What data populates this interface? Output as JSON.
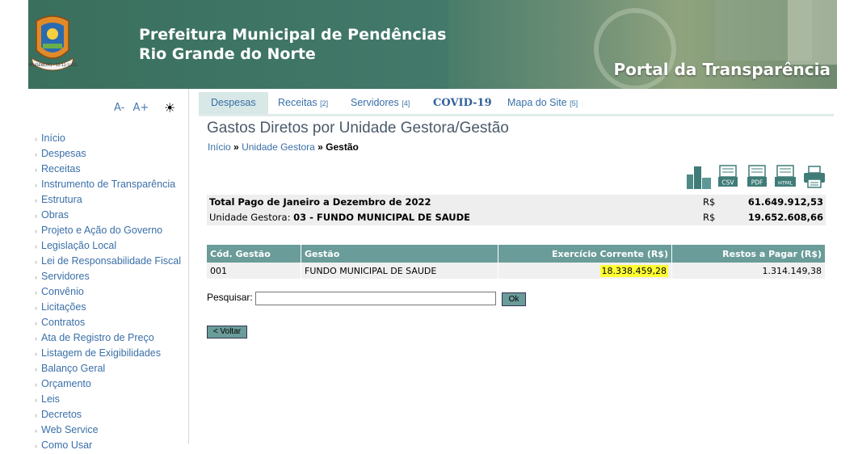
{
  "header": {
    "title_line1": "Prefeitura Municipal de Pendências",
    "title_line2": "Rio Grande do Norte",
    "portal": "Portal da Transparência",
    "logo_text": "PENDENCIAS - 12-12-1953"
  },
  "font_controls": {
    "decrease": "A-",
    "increase": "A+",
    "contrast": "☀"
  },
  "menu": [
    "Início",
    "Despesas",
    "Receitas",
    "Instrumento de Transparência",
    "Estrutura",
    "Obras",
    "Projeto e Ação do Governo",
    "Legislação Local",
    "Lei de Responsabilidade Fiscal",
    "Servidores",
    "Convênio",
    "Licitações",
    "Contratos",
    "Ata de Registro de Preço",
    "Listagem de Exigibilidades",
    "Balanço Geral",
    "Orçamento",
    "Leis",
    "Decretos",
    "Web Service",
    "Como Usar"
  ],
  "tabs": {
    "despesas": "Despesas",
    "receitas": "Receitas",
    "receitas_key": "[2]",
    "servidores": "Servidores",
    "servidores_key": "[4]",
    "covid": "COVID-19",
    "mapa": "Mapa do Site",
    "mapa_key": "[5]"
  },
  "page_title": "Gastos Diretos por Unidade Gestora/Gestão",
  "breadcrumb": {
    "inicio": "Início",
    "sep": "»",
    "unidade": "Unidade Gestora",
    "current": "Gestão"
  },
  "exports": {
    "csv": "CSV",
    "pdf": "PDF",
    "html": "HTML"
  },
  "summary": {
    "total_label": "Total Pago de Janeiro a Dezembro de 2022",
    "total_currency": "R$",
    "total_value": "61.649.912,53",
    "unidade_label": "Unidade Gestora:",
    "unidade_name": "03 - FUNDO MUNICIPAL DE SAUDE",
    "unidade_currency": "R$",
    "unidade_value": "19.652.608,66"
  },
  "table": {
    "headers": [
      "Cód. Gestão",
      "Gestão",
      "Exercício Corrente (R$)",
      "Restos a Pagar (R$)"
    ],
    "rows": [
      [
        "001",
        "FUNDO MUNICIPAL DE SAUDE",
        "18.338.459,28",
        "1.314.149,38"
      ]
    ]
  },
  "search": {
    "label": "Pesquisar:",
    "value": "",
    "ok": "Ok"
  },
  "back": "< Voltar",
  "colors": {
    "header_green": "#3f7864",
    "table_header": "#6a9c99",
    "link": "#3a6fa8",
    "highlight": "#ffff33"
  }
}
